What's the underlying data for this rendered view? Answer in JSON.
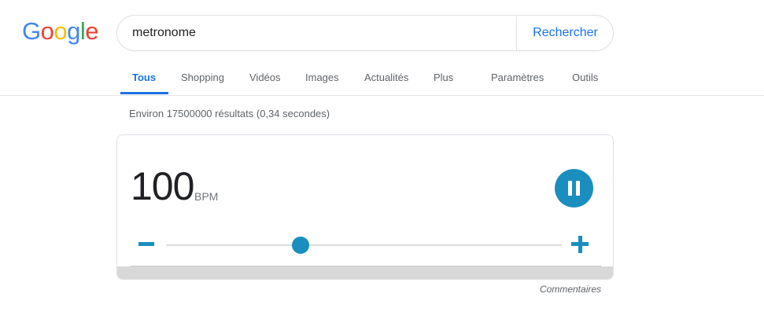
{
  "logo": {
    "text": "Google",
    "letters": [
      {
        "char": "G",
        "color": "#4285F4"
      },
      {
        "char": "o",
        "color": "#EA4335"
      },
      {
        "char": "o",
        "color": "#FBBC05"
      },
      {
        "char": "g",
        "color": "#4285F4"
      },
      {
        "char": "l",
        "color": "#34A853"
      },
      {
        "char": "e",
        "color": "#EA4335"
      }
    ]
  },
  "search": {
    "value": "metronome",
    "button_label": "Rechercher"
  },
  "tabs": [
    {
      "label": "Tous",
      "active": true
    },
    {
      "label": "Shopping",
      "active": false
    },
    {
      "label": "Vidéos",
      "active": false
    },
    {
      "label": "Images",
      "active": false
    },
    {
      "label": "Actualités",
      "active": false
    },
    {
      "label": "Plus",
      "active": false
    },
    {
      "label": "Paramètres",
      "active": false
    },
    {
      "label": "Outils",
      "active": false
    }
  ],
  "result_stats": "Environ 17500000 résultats (0,34 secondes)",
  "metronome": {
    "bpm": "100",
    "unit": "BPM",
    "state": "playing",
    "play_icon": "pause-icon",
    "slider_fraction": 0.34,
    "accent_color": "#1a8fbf"
  },
  "feedback": "Commentaires",
  "colors": {
    "link_blue": "#1a73e8",
    "muted_text": "#5f6368"
  }
}
